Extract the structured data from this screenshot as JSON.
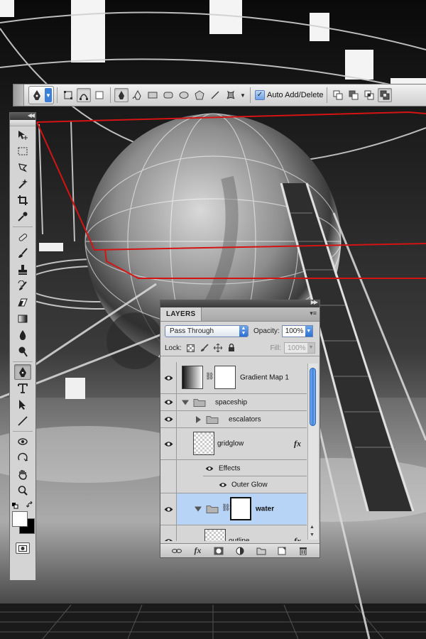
{
  "options_bar": {
    "auto_add_delete": {
      "label": "Auto Add/Delete",
      "checked": true
    }
  },
  "layers_panel": {
    "tab_label": "LAYERS",
    "blend_mode": "Pass Through",
    "opacity_label": "Opacity:",
    "opacity_value": "100%",
    "lock_label": "Lock:",
    "fill_label": "Fill:",
    "fill_value": "100%",
    "layers": [
      {
        "name": "Gradient Map 1",
        "type": "adjustment",
        "visible": true,
        "selected": false
      },
      {
        "name": "spaceship",
        "type": "group",
        "expanded": true,
        "visible": true,
        "selected": false
      },
      {
        "name": "escalators",
        "type": "group",
        "expanded": false,
        "visible": true,
        "selected": false
      },
      {
        "name": "gridglow",
        "type": "layer",
        "fx": true,
        "visible": true,
        "selected": false
      },
      {
        "name": "Effects",
        "type": "effects",
        "visible": true
      },
      {
        "name": "Outer Glow",
        "type": "effect",
        "visible": true
      },
      {
        "name": "water",
        "type": "group",
        "expanded": true,
        "masked": true,
        "visible": true,
        "selected": true
      },
      {
        "name": "outline",
        "type": "layer",
        "fx": true,
        "visible": true,
        "selected": false
      }
    ],
    "fx_badge": "fx"
  },
  "colors": {
    "foreground": "#ffffff",
    "background": "#000000",
    "path_stroke": "#d41414",
    "selection_highlight": "#b7d3f5"
  }
}
